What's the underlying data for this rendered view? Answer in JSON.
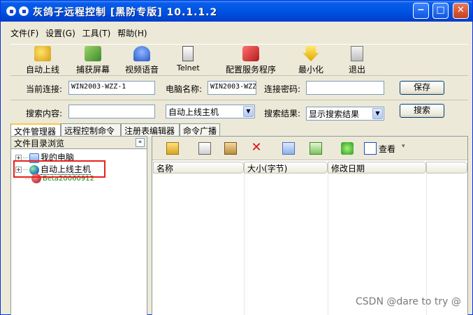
{
  "window": {
    "title": "灰鸽子远程控制  [黑防专版]    10.1.1.2"
  },
  "title_buttons": {
    "minimize": "−",
    "maximize": "□",
    "close": "✕"
  },
  "menu": [
    "文件(F)",
    "设置(G)",
    "工具(T)",
    "帮助(H)"
  ],
  "toolbar": [
    {
      "label": "自动上线",
      "icon": "auto-online-icon"
    },
    {
      "label": "捕获屏幕",
      "icon": "capture-screen-icon"
    },
    {
      "label": "视频语音",
      "icon": "video-voice-icon"
    },
    {
      "label": "Telnet",
      "icon": "telnet-icon"
    },
    {
      "label": "配置服务程序",
      "icon": "config-service-icon"
    },
    {
      "label": "最小化",
      "icon": "minimize-icon"
    },
    {
      "label": "退出",
      "icon": "exit-icon"
    }
  ],
  "connection": {
    "current_label": "当前连接:",
    "current_value": "WIN2003-WZZ-1",
    "computer_label": "电脑名称:",
    "computer_value": "WIN2003-WZZ",
    "password_label": "连接密码:",
    "password_value": "",
    "save_label": "保存"
  },
  "search": {
    "content_label": "搜索内容:",
    "content_value": "",
    "scope_value": "自动上线主机",
    "result_label": "搜索结果:",
    "result_value": "显示搜索结果",
    "search_label": "搜索"
  },
  "tabs": [
    "文件管理器",
    "远程控制命令",
    "注册表编辑器",
    "命令广播"
  ],
  "left_panel": {
    "title": "文件目录浏览",
    "collapse_label": "«",
    "tree": [
      {
        "label": "我的电脑",
        "expander": "+"
      },
      {
        "label": "自动上线主机",
        "expander": "+"
      },
      {
        "label": "Beta20060912",
        "expander": ""
      }
    ]
  },
  "right_panel": {
    "view_label": "查看",
    "view_arrow": "▾",
    "columns": [
      "名称",
      "大小(字节)",
      "修改日期"
    ]
  },
  "watermark": "CSDN @dare to try @"
}
